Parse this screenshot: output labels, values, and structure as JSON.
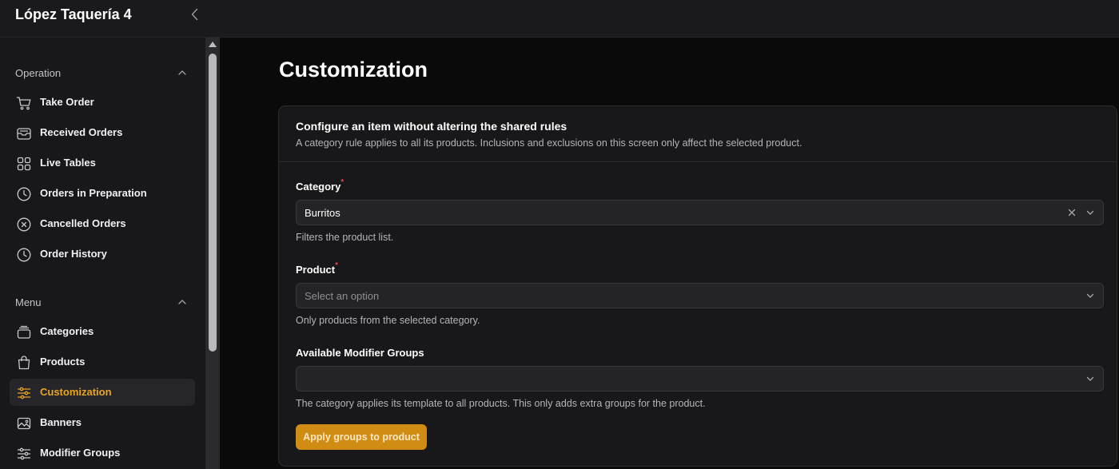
{
  "app": {
    "title": "López Taquería 4"
  },
  "sidebar": {
    "sections": [
      {
        "label": "Operation",
        "items": [
          {
            "label": "Take Order",
            "icon": "cart-icon"
          },
          {
            "label": "Received Orders",
            "icon": "inbox-icon"
          },
          {
            "label": "Live Tables",
            "icon": "grid-icon"
          },
          {
            "label": "Orders in Preparation",
            "icon": "clock-icon"
          },
          {
            "label": "Cancelled Orders",
            "icon": "circle-x-icon"
          },
          {
            "label": "Order History",
            "icon": "clock-icon"
          }
        ]
      },
      {
        "label": "Menu",
        "items": [
          {
            "label": "Categories",
            "icon": "layers-icon"
          },
          {
            "label": "Products",
            "icon": "shopping-bag-icon"
          },
          {
            "label": "Customization",
            "icon": "sliders-icon",
            "active": true
          },
          {
            "label": "Banners",
            "icon": "image-icon"
          },
          {
            "label": "Modifier Groups",
            "icon": "sliders-icon"
          }
        ]
      }
    ]
  },
  "page": {
    "title": "Customization",
    "card": {
      "title": "Configure an item without altering the shared rules",
      "description": "A category rule applies to all its products. Inclusions and exclusions on this screen only affect the selected product."
    },
    "fields": {
      "category": {
        "label": "Category",
        "required_mark": "*",
        "value": "Burritos",
        "help": "Filters the product list."
      },
      "product": {
        "label": "Product",
        "required_mark": "*",
        "placeholder": "Select an option",
        "help": "Only products from the selected category."
      },
      "modifier_groups": {
        "label": "Available Modifier Groups",
        "value": "",
        "help": "The category applies its template to all products. This only adds extra groups for the product."
      }
    },
    "apply_button": "Apply groups to product"
  },
  "colors": {
    "accent": "#e9a420",
    "button": "#d18c14",
    "background": "#0a0a0b",
    "panel": "#18181a"
  }
}
